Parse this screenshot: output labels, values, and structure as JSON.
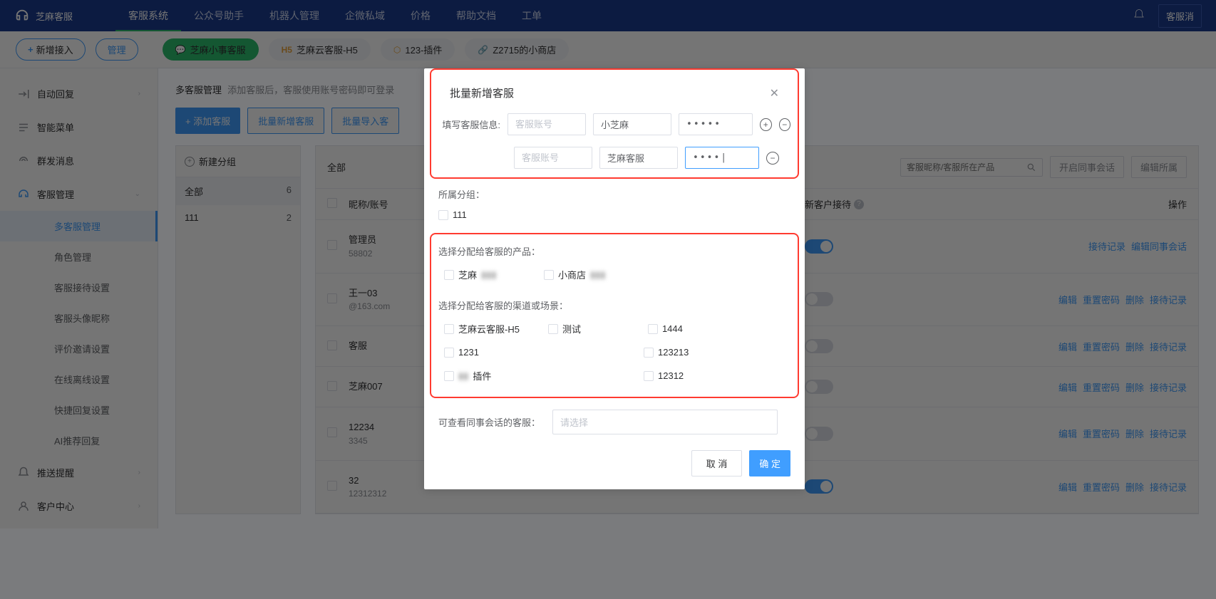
{
  "brand": "芝麻客服",
  "nav": [
    "客服系统",
    "公众号助手",
    "机器人管理",
    "企微私域",
    "价格",
    "帮助文档",
    "工单"
  ],
  "nav_active": 0,
  "consult_btn": "客服消",
  "subbar": {
    "new_access": "新增接入",
    "manage": "管理",
    "tabs": [
      {
        "label": "芝麻小事客服",
        "variant": "green"
      },
      {
        "label": "芝麻云客服-H5",
        "prefix": "H5",
        "variant": "orange"
      },
      {
        "label": "123-插件",
        "variant": "orange",
        "icon": "⬡"
      },
      {
        "label": "Z2715的小商店",
        "variant": "orange",
        "icon": "🔗"
      }
    ]
  },
  "sidebar": {
    "items": [
      {
        "label": "自动回复",
        "icon": "reply",
        "chev": "›"
      },
      {
        "label": "智能菜单",
        "icon": "menu"
      },
      {
        "label": "群发消息",
        "icon": "broadcast"
      },
      {
        "label": "客服管理",
        "icon": "agent",
        "active": true,
        "chev": "⌄",
        "subs": [
          {
            "label": "多客服管理",
            "active": true
          },
          {
            "label": "角色管理"
          },
          {
            "label": "客服接待设置"
          },
          {
            "label": "客服头像昵称"
          },
          {
            "label": "评价邀请设置"
          },
          {
            "label": "在线离线设置"
          },
          {
            "label": "快捷回复设置"
          },
          {
            "label": "AI推荐回复"
          }
        ]
      },
      {
        "label": "推送提醒",
        "icon": "bell",
        "chev": "›"
      },
      {
        "label": "客户中心",
        "icon": "user",
        "chev": "›"
      }
    ]
  },
  "page": {
    "title": "多客服管理",
    "hint": "添加客服后，客服使用账号密码即可登录",
    "toolbar": {
      "add": "+ 添加客服",
      "batch_add": "批量新增客服",
      "batch_import": "批量导入客"
    },
    "group_head": "新建分组",
    "groups": [
      {
        "name": "全部",
        "count": "6",
        "sel": true
      },
      {
        "name": "111",
        "count": "2"
      }
    ],
    "table": {
      "all_tab": "全部",
      "cols": {
        "nick": "昵称/账号",
        "new": "新客户接待",
        "op": "操作"
      },
      "search_placeholder": "客服昵称/客服所在产品",
      "btn_open_peer": "开启同事会话",
      "btn_edit_all": "编辑所属",
      "rows": [
        {
          "nick": "管理员",
          "sub": "58802",
          "switch": true,
          "ops": [
            "接待记录",
            "编辑同事会话"
          ]
        },
        {
          "nick": "王一03",
          "sub": "@163.com",
          "switch": false,
          "ops": [
            "编辑",
            "重置密码",
            "删除",
            "接待记录"
          ]
        },
        {
          "nick": "客服",
          "sub": "",
          "switch": false,
          "ops": [
            "编辑",
            "重置密码",
            "删除",
            "接待记录"
          ]
        },
        {
          "nick": "芝麻007",
          "sub": "",
          "switch": false,
          "ops": [
            "编辑",
            "重置密码",
            "删除",
            "接待记录"
          ]
        },
        {
          "nick": "12234",
          "sub": "3345",
          "switch": false,
          "ops": [
            "编辑",
            "重置密码",
            "删除",
            "接待记录"
          ]
        },
        {
          "nick": "32",
          "sub": "12312312",
          "switch": true,
          "ops": [
            "编辑",
            "重置密码",
            "删除",
            "接待记录"
          ]
        }
      ]
    }
  },
  "modal": {
    "title": "批量新增客服",
    "form_label": "填写客服信息:",
    "account_placeholder": "客服账号",
    "rows": [
      {
        "account": "",
        "name": "小芝麻",
        "pw": "•••••"
      },
      {
        "account": "",
        "name": "芝麻客服",
        "pw": "••••|",
        "focus": true
      }
    ],
    "group_label": "所属分组：",
    "group_options": [
      "111"
    ],
    "product_label": "选择分配给客服的产品：",
    "products": [
      "芝麻",
      "小商店"
    ],
    "channel_label": "选择分配给客服的渠道或场景：",
    "channels": [
      "芝麻云客服-H5",
      "测试",
      "1444",
      "1231",
      "123213",
      "插件",
      "12312"
    ],
    "peer_label": "可查看同事会话的客服：",
    "peer_placeholder": "请选择",
    "cancel": "取 消",
    "ok": "确 定"
  }
}
